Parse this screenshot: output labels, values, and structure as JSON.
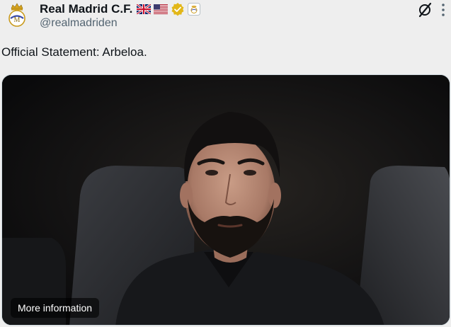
{
  "account": {
    "display_name": "Real Madrid C.F.",
    "handle": "@realmadriden",
    "verified_color": "#e2b719",
    "flags": [
      "uk-flag",
      "us-flag"
    ]
  },
  "tweet": {
    "text": "Official Statement: Arbeloa."
  },
  "media": {
    "more_info_label": "More information"
  },
  "icons": {
    "grok": "grok-icon",
    "more": "more-icon",
    "verified": "verified-badge-icon",
    "affiliate": "affiliate-badge-icon"
  }
}
